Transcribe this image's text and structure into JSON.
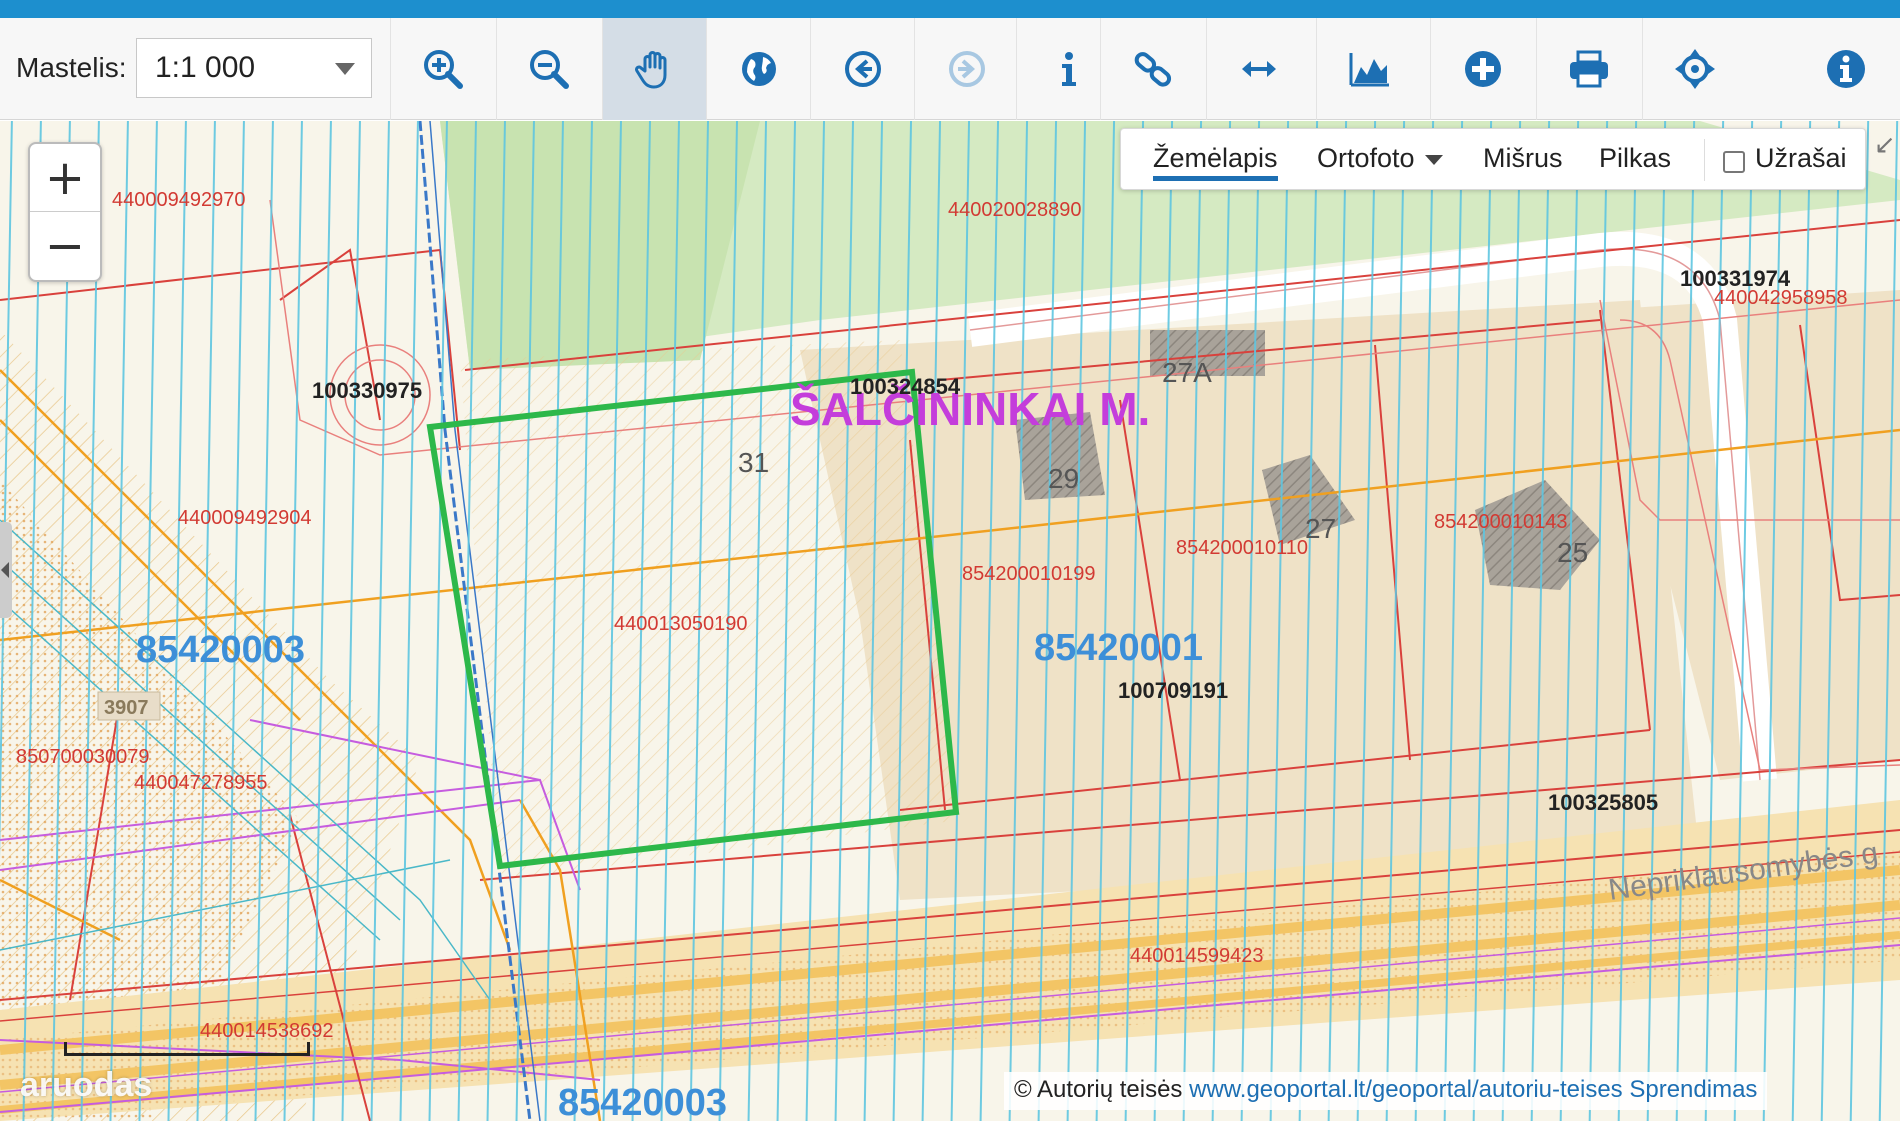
{
  "toolbar": {
    "scale_label": "Mastelis:",
    "scale_value": "1:1 000",
    "tools": [
      {
        "name": "zoom-in-icon"
      },
      {
        "name": "zoom-out-icon"
      },
      {
        "name": "pan-hand-icon",
        "active": true
      },
      {
        "name": "globe-icon"
      },
      {
        "name": "back-arrow-icon"
      },
      {
        "name": "forward-arrow-icon",
        "disabled": true
      },
      {
        "name": "info-i-icon"
      },
      {
        "name": "link-icon"
      },
      {
        "name": "measure-distance-icon"
      },
      {
        "name": "elevation-profile-icon"
      },
      {
        "name": "add-plus-icon"
      },
      {
        "name": "print-icon"
      },
      {
        "name": "locate-crosshair-icon"
      },
      {
        "name": "about-info-icon"
      }
    ]
  },
  "zoom": {
    "plus": "+",
    "minus": "−"
  },
  "layer_switch": {
    "items": [
      "Žemėlapis",
      "Ortofoto",
      "Mišrus",
      "Pilkas"
    ],
    "active": "Žemėlapis",
    "notes_label": "Užrašai",
    "notes_checked": false
  },
  "map": {
    "town": "ŠALČININKAI M.",
    "street": "Nepriklausomybės g",
    "blocks": [
      "85420003",
      "85420001",
      "85420003"
    ],
    "house_numbers": [
      "31",
      "29",
      "27A",
      "27",
      "25"
    ],
    "parcel_labels": [
      "440009492970",
      "440020028890",
      "440042958958",
      "440009492904",
      "440013050190",
      "854200010199",
      "854200010110",
      "854200010143",
      "850700030079",
      "440047278955",
      "440014599423",
      "440014538692"
    ],
    "object_labels": [
      "100330975",
      "100324854",
      "100331974",
      "100709191",
      "100325805"
    ],
    "small_box": "3907"
  },
  "attribution": {
    "prefix": "© Autorių teisės",
    "link": "www.geoportal.lt/geoportal/autoriu-teises",
    "suffix": "Sprendimas"
  },
  "watermark": "aruodas"
}
